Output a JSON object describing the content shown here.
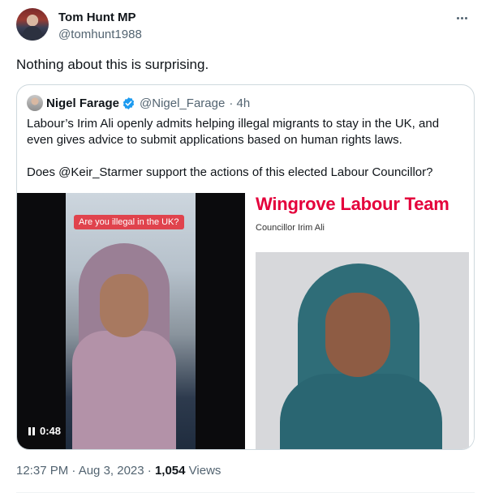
{
  "author": {
    "display_name": "Tom Hunt MP",
    "handle": "@tomhunt1988"
  },
  "tweet": {
    "text": "Nothing about this is surprising."
  },
  "quote": {
    "author_name": "Nigel Farage",
    "handle": "@Nigel_Farage",
    "time": "· 4h",
    "body_1": "Labour’s Irim Ali openly admits helping illegal migrants to stay in the UK, and even gives advice to submit applications based on human rights laws.",
    "body_2": "Does @Keir_Starmer support the actions of this elected Labour Councillor?",
    "video": {
      "overlay_text": "Are you illegal in the UK?",
      "duration": "0:48"
    },
    "image": {
      "title": "Wingrove Labour Team",
      "caption": "Councillor Irim Ali"
    }
  },
  "meta": {
    "timestamp": "12:37 PM · Aug 3, 2023 · ",
    "views_count": "1,054",
    "views_label": " Views"
  },
  "colors": {
    "verified_badge": "#1d9bf0",
    "team_title": "#e4003b",
    "overlay_badge": "#e0434d"
  }
}
